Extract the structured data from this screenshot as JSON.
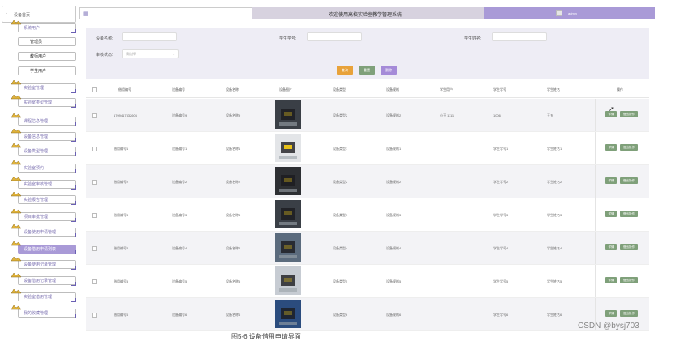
{
  "sidebar": {
    "top": "设备首页",
    "items": [
      {
        "label": "系统用户",
        "kind": "item"
      },
      {
        "label": "管理员",
        "kind": "sub"
      },
      {
        "label": "教师用户",
        "kind": "sub"
      },
      {
        "label": "学生用户",
        "kind": "sub"
      },
      {
        "label": "实验室管理",
        "kind": "item"
      },
      {
        "label": "实验室类型管理",
        "kind": "item"
      },
      {
        "label": "课程信息管理",
        "kind": "item"
      },
      {
        "label": "设备信息管理",
        "kind": "item"
      },
      {
        "label": "设备类型管理",
        "kind": "item"
      },
      {
        "label": "实验室预约",
        "kind": "item"
      },
      {
        "label": "实验室审核管理",
        "kind": "item"
      },
      {
        "label": "实验报告管理",
        "kind": "item"
      },
      {
        "label": "项目审批管理",
        "kind": "item"
      },
      {
        "label": "设备使用申请管理",
        "kind": "item"
      },
      {
        "label": "设备借用申请列表",
        "kind": "item",
        "active": true
      },
      {
        "label": "设备使用记录管理",
        "kind": "item"
      },
      {
        "label": "设备借用记录管理",
        "kind": "item"
      },
      {
        "label": "实验室借用管理",
        "kind": "item"
      },
      {
        "label": "我的收藏管理",
        "kind": "item"
      }
    ]
  },
  "header": {
    "title": "欢迎使用高校实验室教学管理系统",
    "username": "admin"
  },
  "search": {
    "name_label": "设备名称:",
    "student_no_label": "学生学号:",
    "student_name_label": "学生姓名:",
    "audit_label": "审核状态:",
    "audit_placeholder": "请选择",
    "btn_query": "查询",
    "btn_reset": "重置",
    "btn_delete": "删除"
  },
  "table": {
    "columns": [
      "借用编号",
      "设备编号",
      "设备名称",
      "设备图片",
      "设备类型",
      "设备规格",
      "学生用户",
      "学生学号",
      "学生姓名",
      "操作"
    ],
    "rows": [
      {
        "no": "1709417332606",
        "dev_no": "设备编号9",
        "dev_name": "设备名称9",
        "type": "设备类型2",
        "spec": "设备规格2",
        "user": "小王 1111",
        "stu_no": "1006",
        "stu_name": "王五"
      },
      {
        "no": "借用编号1",
        "dev_no": "设备编号1",
        "dev_name": "设备名称1",
        "type": "设备类型1",
        "spec": "设备规格1",
        "user": "",
        "stu_no": "学生学号1",
        "stu_name": "学生姓名1"
      },
      {
        "no": "借用编号2",
        "dev_no": "设备编号2",
        "dev_name": "设备名称2",
        "type": "设备类型2",
        "spec": "设备规格2",
        "user": "",
        "stu_no": "学生学号2",
        "stu_name": "学生姓名2"
      },
      {
        "no": "借用编号3",
        "dev_no": "设备编号3",
        "dev_name": "设备名称3",
        "type": "设备类型3",
        "spec": "设备规格3",
        "user": "",
        "stu_no": "学生学号3",
        "stu_name": "学生姓名3"
      },
      {
        "no": "借用编号4",
        "dev_no": "设备编号4",
        "dev_name": "设备名称4",
        "type": "设备类型4",
        "spec": "设备规格4",
        "user": "",
        "stu_no": "学生学号4",
        "stu_name": "学生姓名4"
      },
      {
        "no": "借用编号5",
        "dev_no": "设备编号5",
        "dev_name": "设备名称5",
        "type": "设备类型5",
        "spec": "设备规格5",
        "user": "",
        "stu_no": "学生学号5",
        "stu_name": "学生姓名5"
      },
      {
        "no": "借用编号6",
        "dev_no": "设备编号6",
        "dev_name": "设备名称6",
        "type": "设备类型6",
        "spec": "设备规格6",
        "user": "",
        "stu_no": "学生学号6",
        "stu_name": "学生姓名6"
      }
    ],
    "op_detail": "详情",
    "op_borrow": "借出操作"
  },
  "colors": {
    "accent": "#a99ad7",
    "query": "#e8a23a",
    "reset": "#7fa07a",
    "delete": "#a58bd8"
  },
  "caption": "图5-6 设备借用申请界面",
  "watermark": "CSDN @bysj703"
}
